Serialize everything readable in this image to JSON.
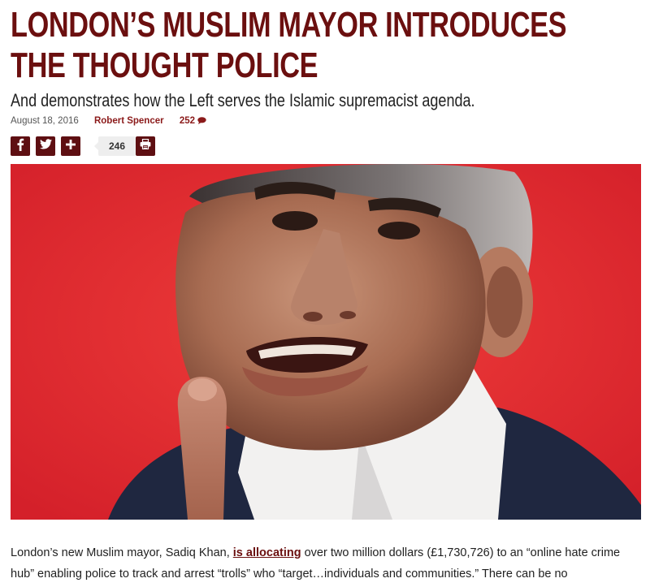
{
  "article": {
    "headline_line1": "LONDON’S MUSLIM MAYOR INTRODUCES",
    "headline_line2": "THE THOUGHT POLICE",
    "subheadline": "And demonstrates how the Left serves the Islamic supremacist agenda.",
    "date": "August 18, 2016",
    "author": "Robert Spencer",
    "comment_count": "252"
  },
  "share": {
    "count": "246",
    "icons": [
      "facebook-icon",
      "twitter-icon",
      "plus-icon",
      "print-icon"
    ]
  },
  "body": {
    "text_before_link": "London’s new Muslim mayor, Sadiq Khan, ",
    "link_text": "is allocating",
    "text_after_link": " over two million dollars (£1,730,726) to an “online hate crime hub” enabling police to track and arrest “trolls” who “target…individuals and communities.” There can be no"
  },
  "colors": {
    "headline": "#6b0f0f",
    "share_button": "#5e0f12",
    "hero_background": "#e12a2c"
  }
}
